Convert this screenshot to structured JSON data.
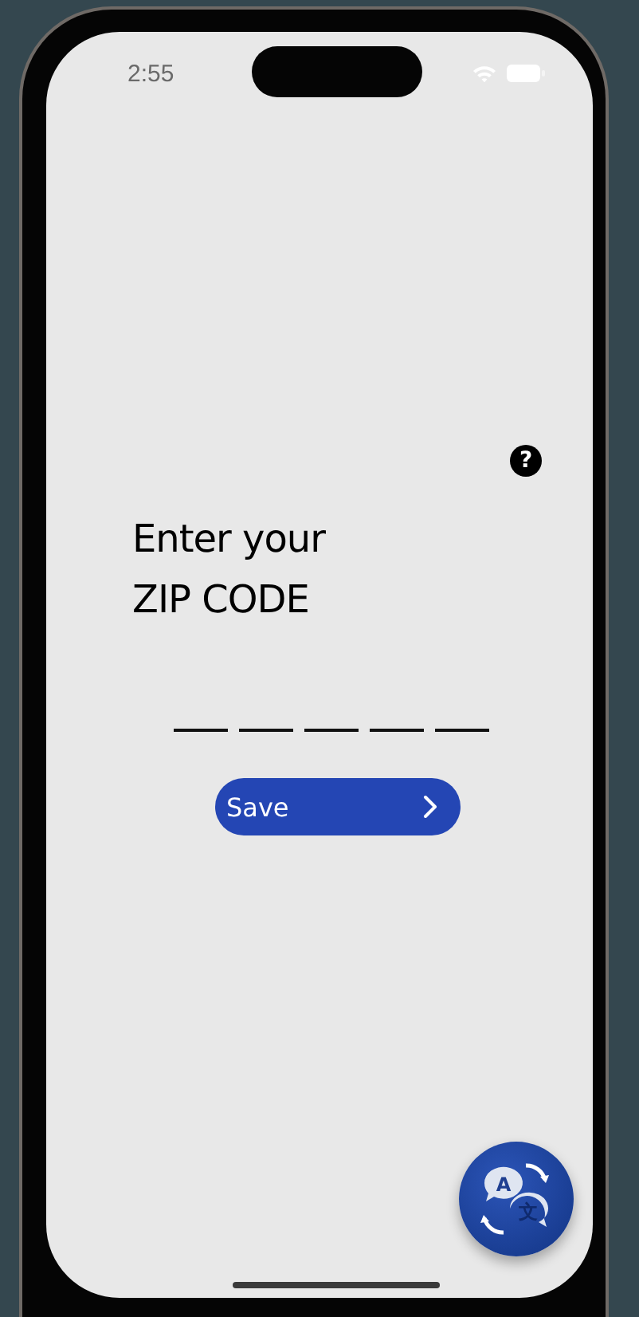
{
  "status_bar": {
    "time": "2:55"
  },
  "help_button": {
    "label": "?"
  },
  "title": {
    "lines": [
      "Enter your",
      "ZIP CODE"
    ]
  },
  "zip_slots": [
    {
      "filled": false
    },
    {
      "filled": false
    },
    {
      "filled": false
    },
    {
      "filled": false
    },
    {
      "filled": false
    }
  ],
  "save_button": {
    "label": "Save"
  },
  "translate_button": {
    "glyphs": [
      "A",
      "文"
    ]
  }
}
